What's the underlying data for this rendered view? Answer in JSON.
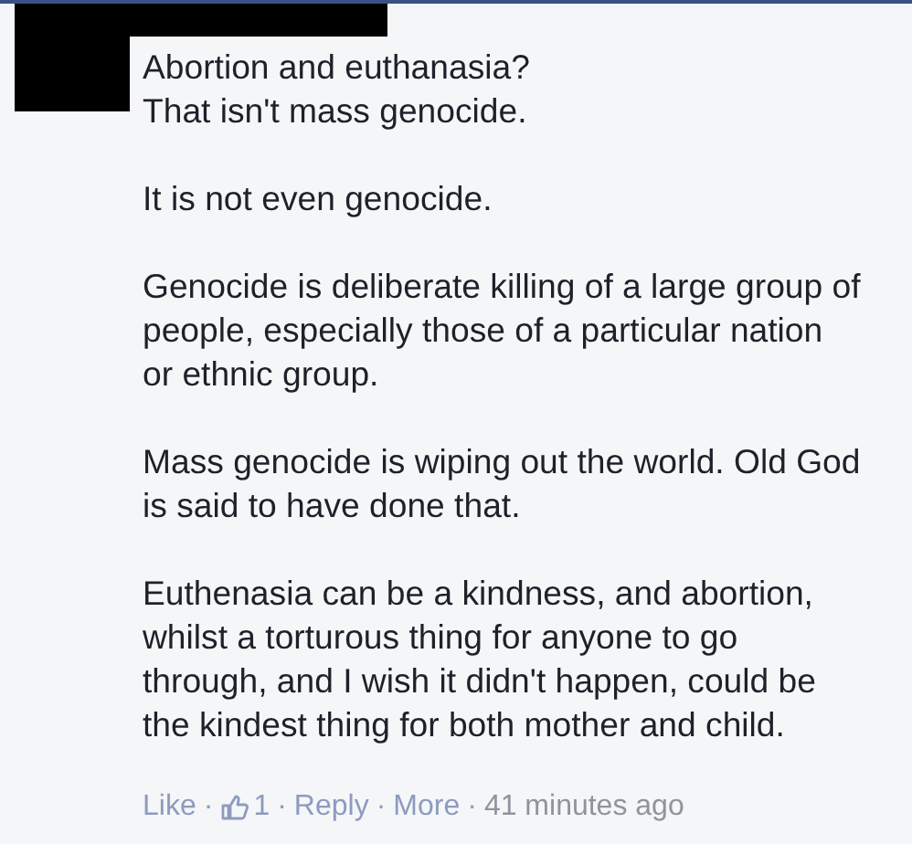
{
  "comment": {
    "author": {
      "redacted": true
    },
    "paragraphs": [
      [
        "Abortion and euthanasia?",
        "That isn't mass genocide."
      ],
      [
        "It is not even genocide."
      ],
      [
        "Genocide is deliberate killing of a large group of",
        "people, especially those of a particular nation",
        "or ethnic group."
      ],
      [
        "Mass genocide is wiping out the world. Old God",
        "is said to have done that."
      ],
      [
        "Euthenasia can be a kindness, and abortion,",
        "whilst a torturous thing for anyone to go",
        "through, and I wish it didn't happen, could be",
        "the kindest thing for both mother and child."
      ]
    ],
    "actions": {
      "like": "Like",
      "separator": "·",
      "like_count": "1",
      "reply": "Reply",
      "more": "More",
      "time": "41 minutes ago"
    }
  }
}
